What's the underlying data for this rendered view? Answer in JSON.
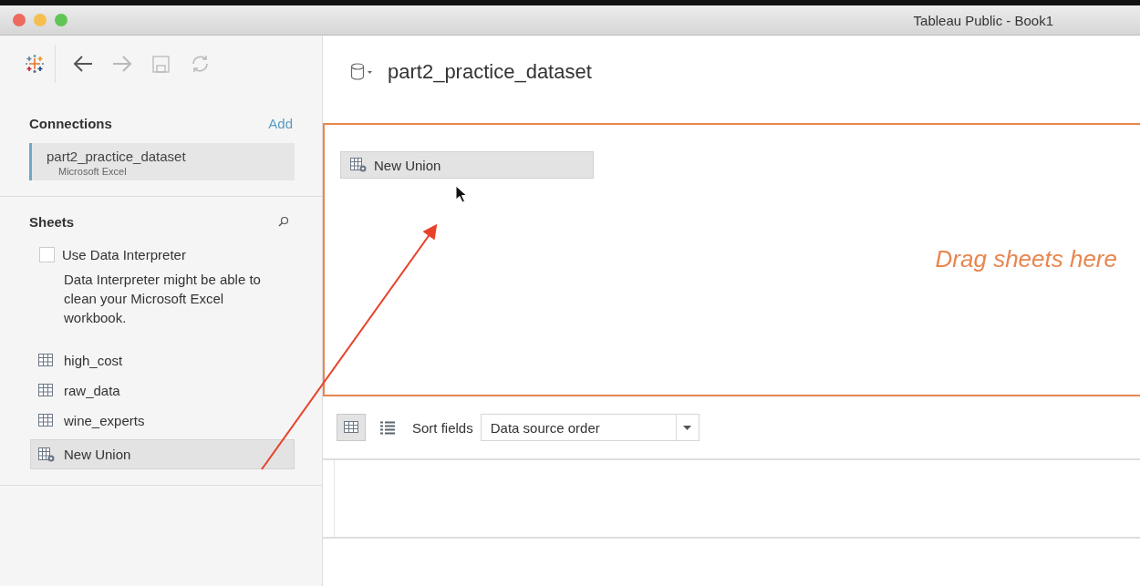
{
  "window": {
    "title": "Tableau Public - Book1"
  },
  "toolbar": [
    {
      "kind": "back",
      "disabled": false
    },
    {
      "kind": "forward",
      "disabled": true
    },
    {
      "kind": "save",
      "disabled": true
    },
    {
      "kind": "refresh",
      "disabled": true
    }
  ],
  "connections": {
    "heading": "Connections",
    "add": "Add",
    "items": [
      {
        "name": "part2_practice_dataset",
        "type": "Microsoft Excel",
        "selected": true
      }
    ]
  },
  "sheets": {
    "heading": "Sheets",
    "interpreter": {
      "label": "Use Data Interpreter",
      "checked": false
    },
    "hint": "Data Interpreter might be able to clean your Microsoft Excel workbook.",
    "items": [
      {
        "name": "high_cost",
        "kind": "table",
        "selected": false
      },
      {
        "name": "raw_data",
        "kind": "table",
        "selected": false
      },
      {
        "name": "wine_experts",
        "kind": "table",
        "selected": false
      },
      {
        "name": "New Union",
        "kind": "union",
        "selected": true
      }
    ]
  },
  "datasource": {
    "title": "part2_practice_dataset"
  },
  "canvas": {
    "dragged_item": "New Union",
    "hint": "Drag sheets here"
  },
  "grid_toolbar": {
    "views": [
      {
        "kind": "grid",
        "selected": true
      },
      {
        "kind": "list",
        "selected": false
      }
    ],
    "sort_label": "Sort fields",
    "sort_value": "Data source order"
  }
}
